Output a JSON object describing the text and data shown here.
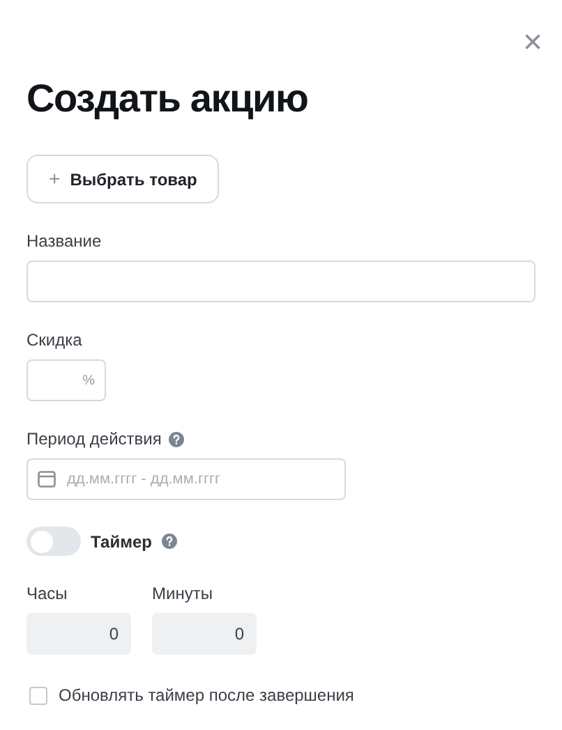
{
  "dialog": {
    "title": "Создать акцию",
    "close_label": "×"
  },
  "select_product_button": {
    "icon": "+",
    "label": "Выбрать товар"
  },
  "name_field": {
    "label": "Название"
  },
  "discount_field": {
    "label": "Скидка",
    "suffix": "%"
  },
  "period_field": {
    "label": "Период действия",
    "placeholder": "дд.мм.гггг - дд.мм.гггг"
  },
  "timer": {
    "label": "Таймер",
    "on": false
  },
  "time_fields": [
    {
      "label": "Часы",
      "value": "0",
      "disabled": true
    },
    {
      "label": "Минуты",
      "value": "0",
      "disabled": true
    }
  ],
  "renew_checkbox": {
    "label": "Обновлять таймер после завершения",
    "checked": false
  }
}
